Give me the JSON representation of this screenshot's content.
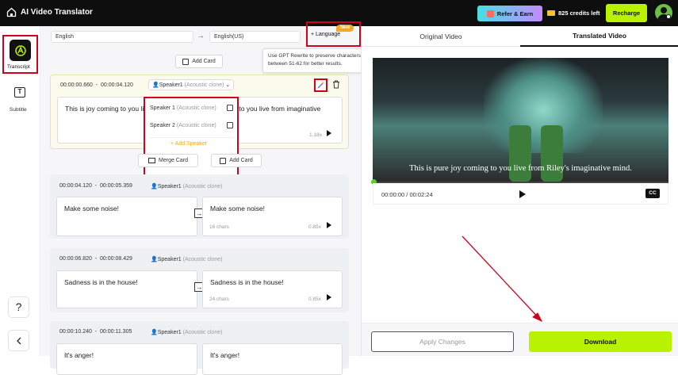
{
  "header": {
    "title": "AI Video Translator",
    "refer_label": "Refer & Earn",
    "credits_label": "825 credits left",
    "recharge_label": "Recharge"
  },
  "sidebar": {
    "items": [
      {
        "label": "Transcript",
        "icon": "translate-icon"
      },
      {
        "label": "Subtitle",
        "icon": "subtitle-icon"
      }
    ],
    "help_icon": "question-icon",
    "collapse_icon": "chevron-left-icon"
  },
  "toolbar": {
    "source_language": "English",
    "target_language": "English(US)",
    "add_language_label": "+ Language",
    "new_badge": "New",
    "tooltip": "Use GPT Rewrite to preserve characters between 51-62 for better results."
  },
  "add_card_label": "Add Card",
  "merge_card_label": "Merge Card",
  "speaker_dropdown": {
    "options": [
      {
        "name": "Speaker 1",
        "tag": "(Acoustic clone)"
      },
      {
        "name": "Speaker 2",
        "tag": "(Acoustic clone)"
      }
    ],
    "add_label": "+ Add Speaker"
  },
  "cards": [
    {
      "start": "00:00:00.660",
      "end": "00:00:04.120",
      "speaker": "Speaker1",
      "tag": "(Acoustic clone)",
      "source": "This is joy coming to you live from mind.",
      "target": "y coming to you live from imaginative mind.",
      "chars": "",
      "speed": "1.18x"
    },
    {
      "start": "00:00:04.120",
      "end": "00:00:05.359",
      "speaker": "Speaker1",
      "tag": "(Acoustic clone)",
      "source": "Make some noise!",
      "target": "Make some noise!",
      "chars": "16 chars",
      "speed": "0.85x"
    },
    {
      "start": "00:00:06.820",
      "end": "00:00:08.429",
      "speaker": "Speaker1",
      "tag": "(Acoustic clone)",
      "source": "Sadness is in the house!",
      "target": "Sadness is in the house!",
      "chars": "24 chars",
      "speed": "0.85x"
    },
    {
      "start": "00:00:10.240",
      "end": "00:00:11.305",
      "speaker": "Speaker1",
      "tag": "(Acoustic clone)",
      "source": "It's anger!",
      "target": "It's anger!",
      "chars": "",
      "speed": ""
    }
  ],
  "preview": {
    "tab_original": "Original Video",
    "tab_translated": "Translated Video",
    "subtitle": "This is pure joy coming to you live from Riley's imaginative mind.",
    "time": "00:00:00 / 00:02:24",
    "cc_label": "CC",
    "progress": 0.0,
    "apply_label": "Apply Changes",
    "download_label": "Download"
  },
  "colors": {
    "accent": "#b8f200",
    "annotation": "#d0021b",
    "badge": "#f5a623"
  }
}
